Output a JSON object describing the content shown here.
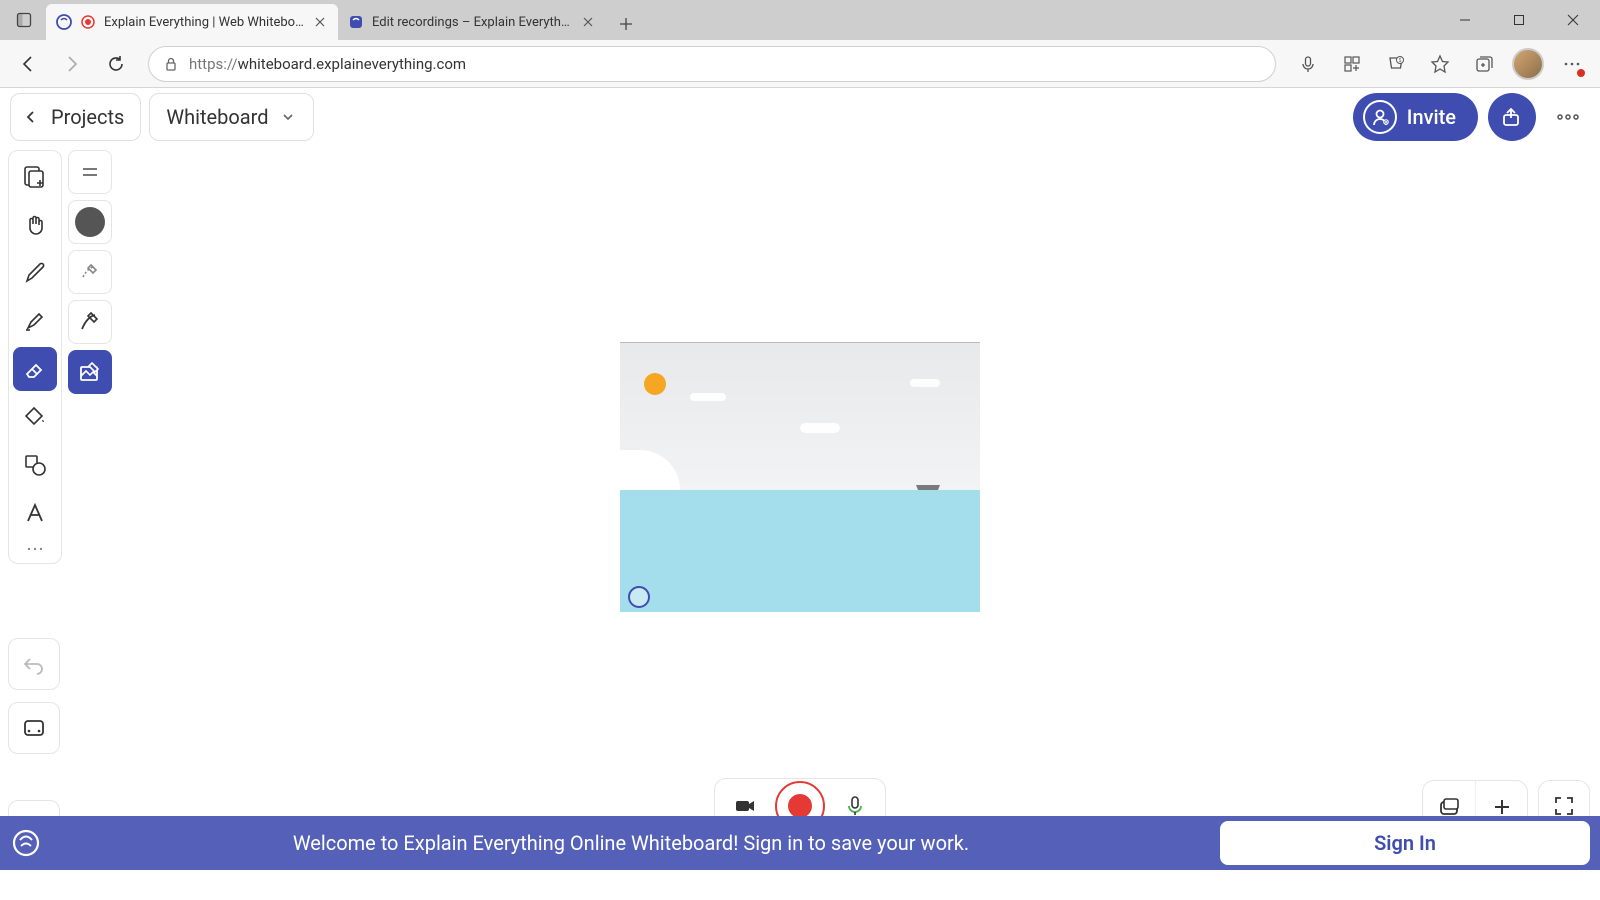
{
  "browser": {
    "tabs": [
      {
        "title": "Explain Everything | Web Whiteboard",
        "active": true
      },
      {
        "title": "Edit recordings – Explain Everything",
        "active": false
      }
    ],
    "url_protocol": "https://",
    "url_rest": "whiteboard.explaineverything.com"
  },
  "app_header": {
    "projects_label": "Projects",
    "document_name": "Whiteboard",
    "invite_label": "Invite"
  },
  "tools": {
    "col1": [
      "add-media",
      "hand",
      "draw",
      "highlighter",
      "eraser",
      "fill",
      "shape",
      "text",
      "more"
    ],
    "col2": [
      "lines",
      "color-fill",
      "erase-partial",
      "erase-stroke",
      "erase-image"
    ],
    "active_primary": "eraser",
    "active_secondary": "erase-image"
  },
  "record": {
    "camera": "camera-icon",
    "record": "record-button",
    "mic": "mic-icon"
  },
  "bottom_right": {
    "slides": "slides-icon",
    "add": "add-slide-icon",
    "fullscreen": "fullscreen-icon"
  },
  "banner": {
    "message": "Welcome to Explain Everything Online Whiteboard! Sign in to save your work.",
    "signin_label": "Sign In"
  }
}
